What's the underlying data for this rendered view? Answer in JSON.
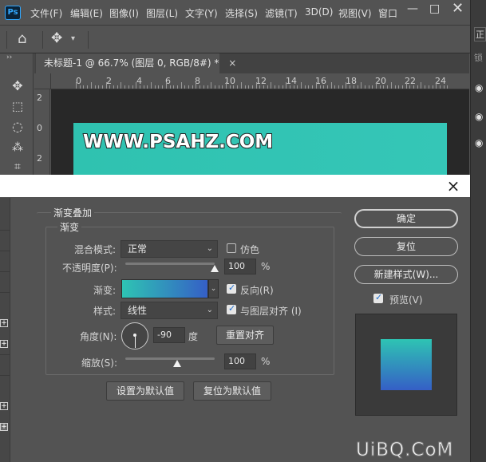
{
  "app": {
    "logo": "Ps"
  },
  "menu": [
    "文件(F)",
    "编辑(E)",
    "图像(I)",
    "图层(L)",
    "文字(Y)",
    "选择(S)",
    "滤镜(T)",
    "3D(D)",
    "视图(V)",
    "窗口"
  ],
  "window_controls": {
    "minimize": "—",
    "maximize": "□"
  },
  "options_bar": {
    "home_icon": "⌂",
    "move_icon": "✥",
    "dropdown": "⌄"
  },
  "document": {
    "tab_label": "未标题-1 @ 66.7% (图层 0, RGB/8#) *",
    "tab_close": "×",
    "ruler_marks": [
      "0",
      "2",
      "4",
      "6",
      "8",
      "10",
      "12",
      "14",
      "16",
      "18",
      "20",
      "22",
      "24"
    ],
    "vruler_marks": [
      "2",
      "0",
      "2"
    ],
    "canvas_text": "WWW.PSAHZ.COM"
  },
  "right_panel": {
    "chars": [
      "正",
      "锁"
    ]
  },
  "dialog": {
    "close": "×",
    "section_title": "渐变叠加",
    "group_title": "渐变",
    "blend_mode_label": "混合模式:",
    "blend_mode_value": "正常",
    "dither_label": "仿色",
    "dither_checked": false,
    "opacity_label": "不透明度(P):",
    "opacity_value": "100",
    "opacity_percent": 100,
    "percent": "%",
    "gradient_label": "渐变:",
    "gradient_colors": [
      "#2ec4b3",
      "#355fc6"
    ],
    "reverse_label": "反向(R)",
    "reverse_checked": true,
    "style_label": "样式:",
    "style_value": "线性",
    "align_label": "与图层对齐 (I)",
    "align_checked": true,
    "angle_label": "角度(N):",
    "angle_value": "-90",
    "degree": "度",
    "reset_align": "重置对齐",
    "scale_label": "缩放(S):",
    "scale_value": "100",
    "scale_percent": 100,
    "set_default": "设置为默认值",
    "reset_default": "复位为默认值",
    "ok": "确定",
    "reset": "复位",
    "new_style": "新建样式(W)...",
    "preview_label": "预览(V)",
    "preview_checked": true
  },
  "site_watermark": "UiBQ.CoM"
}
